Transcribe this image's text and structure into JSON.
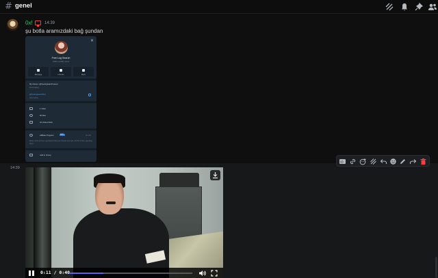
{
  "channel": {
    "name": "genel"
  },
  "header_icons": [
    "threads-icon",
    "bell-icon",
    "pin-icon",
    "members-icon"
  ],
  "message1": {
    "username": "0x!",
    "time": "14:39",
    "text": "şu botla aramızdaki bağ şundan",
    "colors": {
      "username": "#2dc770",
      "device_badge": "#e8424a"
    }
  },
  "card": {
    "close": "×",
    "name": "Free Log Search",
    "subtitle": "1100 monthly users",
    "buttons": [
      "Message",
      "Unmute",
      "More"
    ],
    "owner_line": "My Owner: @freelogsearchowner",
    "owner_caption": "Description",
    "handle": "@freelogsearchbot",
    "handle_caption": "Username",
    "stats": [
      "1 video",
      "20 files",
      "31 shared links"
    ],
    "affiliate": "Affiliate Program",
    "affiliate_badge": "NEW",
    "affiliate_value": "10.3%",
    "affiliate_desc": "Share a link to Free Log Search with your friends and earn 10.3% of their spending there.",
    "add_to_group": "Add to Group"
  },
  "message2": {
    "time": "14:39"
  },
  "video": {
    "current_time": "0:11",
    "duration": "0:40",
    "time_separator": "/",
    "progress": 0.275,
    "accent": "#5865f2"
  },
  "toolbar_icons": [
    "id-icon",
    "link-icon",
    "emoji-reaction-icon",
    "threads-icon",
    "reply-icon",
    "emoji-icon",
    "edit-icon",
    "forward-icon",
    "delete-icon"
  ]
}
